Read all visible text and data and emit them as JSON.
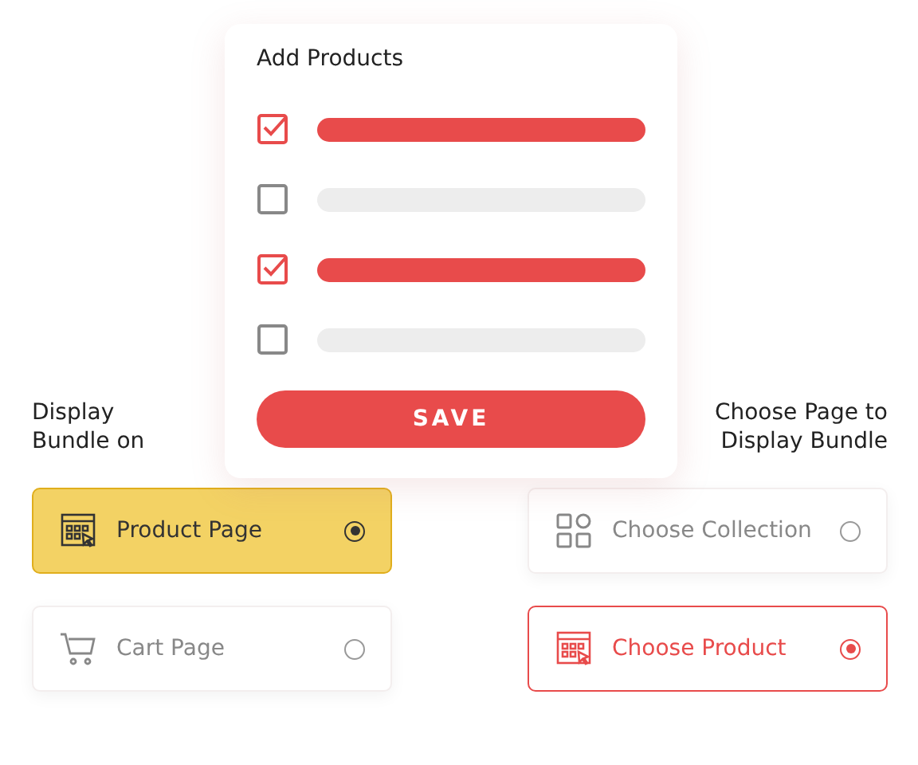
{
  "card": {
    "title": "Add Products",
    "items": [
      {
        "checked": true
      },
      {
        "checked": false
      },
      {
        "checked": true
      },
      {
        "checked": false
      }
    ],
    "button": "SAVE"
  },
  "groups": [
    {
      "label": "Display Bundle on",
      "options": [
        {
          "label": "Product Page",
          "kind": "product",
          "selected": true
        },
        {
          "label": "Cart Page",
          "kind": "cart",
          "selected": false
        }
      ]
    },
    {
      "label": "Choose Page to Display Bundle",
      "options": [
        {
          "label": "Choose Collection",
          "kind": "grid",
          "selected": false
        },
        {
          "label": "Choose Product",
          "kind": "product",
          "selected": true
        }
      ]
    }
  ]
}
